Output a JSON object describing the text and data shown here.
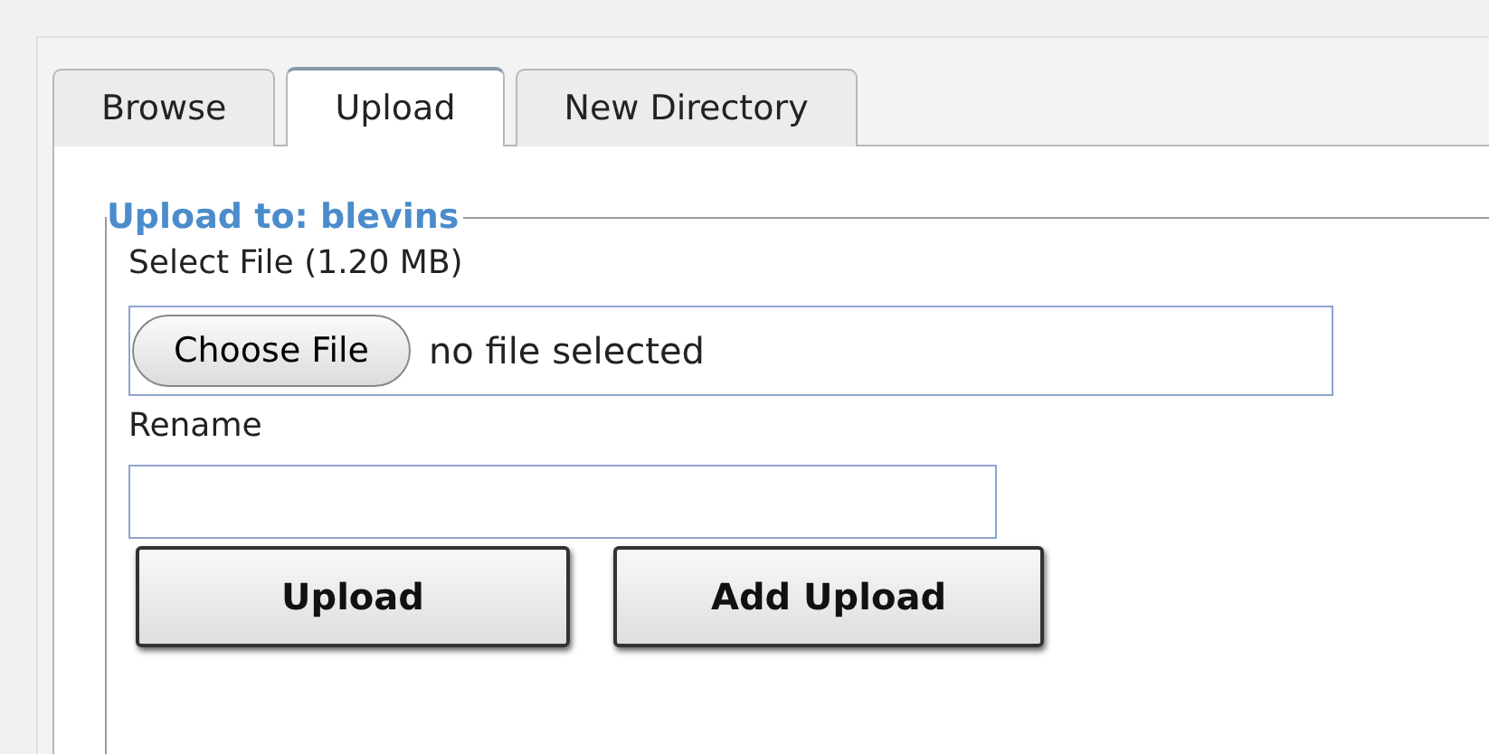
{
  "tabs": [
    {
      "label": "Browse",
      "selected": false
    },
    {
      "label": "Upload",
      "selected": true
    },
    {
      "label": "New Directory",
      "selected": false
    }
  ],
  "form": {
    "legend": "Upload to: blevins",
    "file_label": "Select File (1.20 MB)",
    "choose_button": "Choose File",
    "file_status": "no file selected",
    "rename_label": "Rename",
    "buttons": [
      "Upload",
      "Add Upload"
    ]
  }
}
